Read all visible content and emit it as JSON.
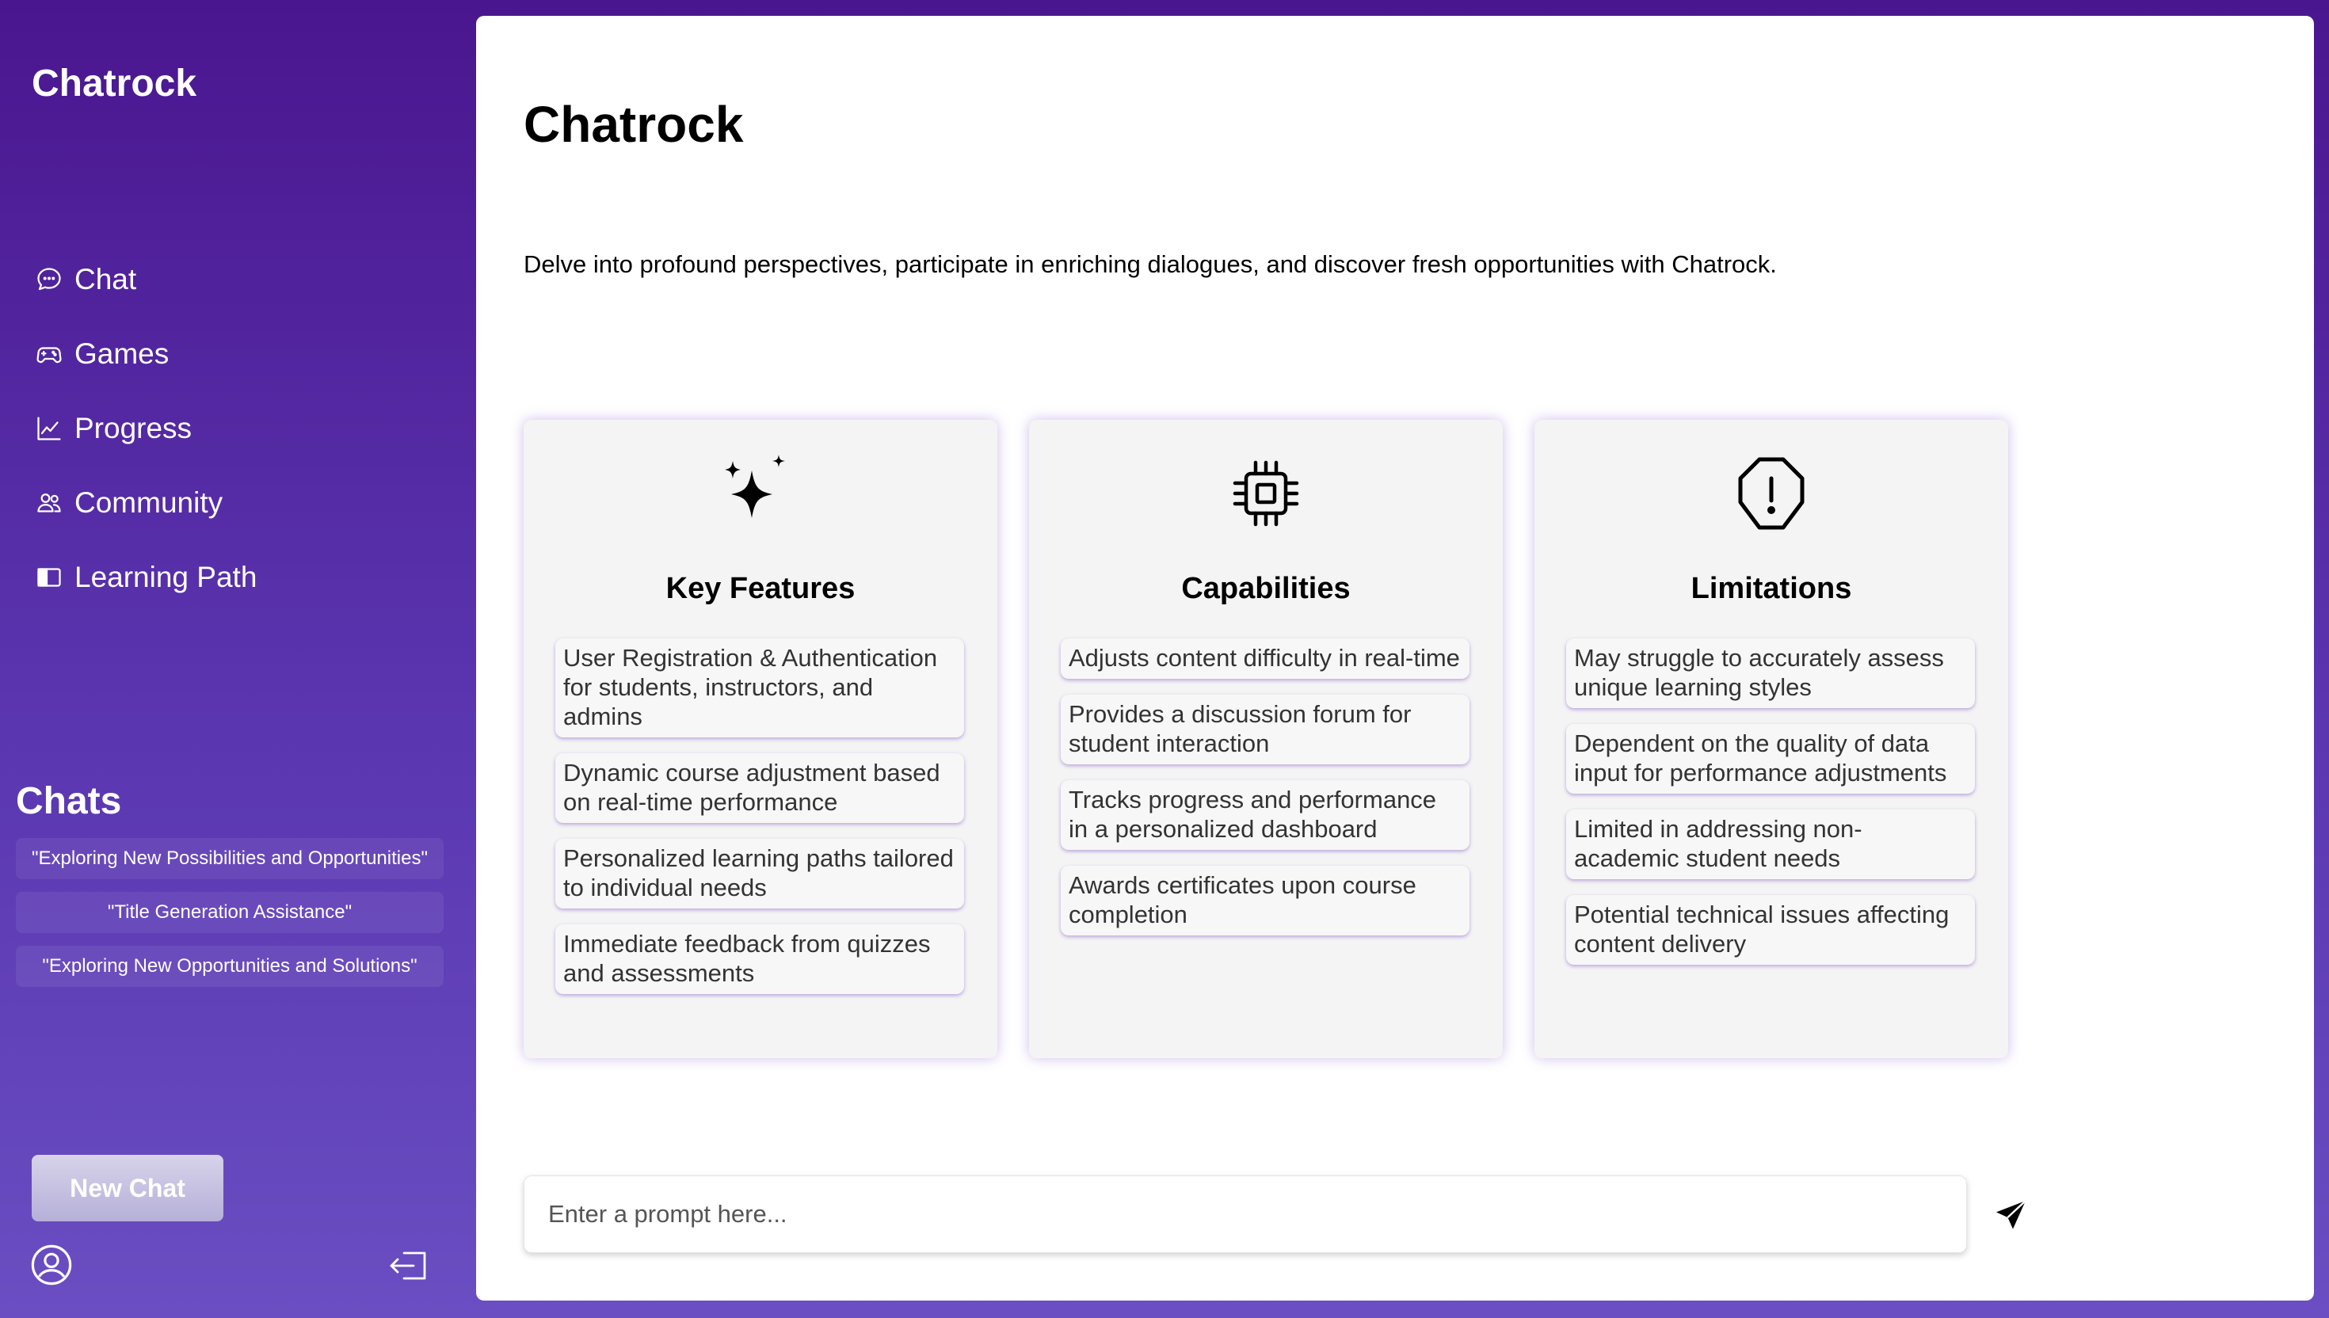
{
  "sidebar": {
    "brand": "Chatrock",
    "nav": [
      {
        "label": "Chat",
        "icon": "chat-bubble-icon"
      },
      {
        "label": "Games",
        "icon": "gamepad-icon"
      },
      {
        "label": "Progress",
        "icon": "line-chart-icon"
      },
      {
        "label": "Community",
        "icon": "people-icon"
      },
      {
        "label": "Learning Path",
        "icon": "book-icon"
      }
    ],
    "chats_title": "Chats",
    "chats": [
      "\"Exploring New Possibilities and Opportunities\"",
      "\"Title Generation Assistance\"",
      "\"Exploring New Opportunities and Solutions\""
    ],
    "new_chat_label": "New Chat",
    "profile_icon": "user-circle-icon",
    "logout_icon": "logout-icon"
  },
  "main": {
    "title": "Chatrock",
    "tagline": "Delve into profound perspectives, participate in enriching dialogues, and discover fresh opportunities with Chatrock.",
    "cards": [
      {
        "title": "Key Features",
        "icon": "sparkles-icon",
        "items": [
          "User Registration & Authentication for students, instructors, and admins",
          "Dynamic course adjustment based on real-time performance",
          "Personalized learning paths tailored to individual needs",
          "Immediate feedback from quizzes and assessments"
        ]
      },
      {
        "title": "Capabilities",
        "icon": "cpu-chip-icon",
        "items": [
          "Adjusts content difficulty in real-time",
          "Provides a discussion forum for student interaction",
          "Tracks progress and performance in a personalized dashboard",
          "Awards certificates upon course completion"
        ]
      },
      {
        "title": "Limitations",
        "icon": "warning-octagon-icon",
        "items": [
          "May struggle to accurately assess unique learning styles",
          "Dependent on the quality of data input for performance adjustments",
          "Limited in addressing non-academic student needs",
          "Potential technical issues affecting content delivery"
        ]
      }
    ],
    "prompt_placeholder": "Enter a prompt here...",
    "send_icon": "send-icon"
  },
  "colors": {
    "sidebar_top": "#4a168f",
    "sidebar_bottom": "#6a4ec2",
    "card_bg": "#f4f4f4",
    "card_glow": "#a070d8"
  }
}
